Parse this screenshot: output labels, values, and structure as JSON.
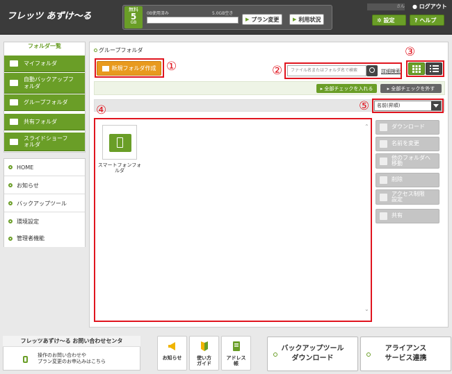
{
  "header": {
    "logo": "フレッツ あずけ〜る",
    "plan_badge": {
      "line1": "無料",
      "line2": "5",
      "line3": "GB"
    },
    "usage_used": "0B使用済み",
    "usage_free": "5.0GB空き",
    "usage_fraction": 0,
    "plan_change_label": "プラン変更",
    "usage_status_label": "利用状況",
    "user_suffix": "さん",
    "logout_label": "ログアウト",
    "settings_label": "設定",
    "help_label": "ヘルプ"
  },
  "sidebar": {
    "title": "フォルダ一覧",
    "folders": [
      {
        "label": "マイフォルダ"
      },
      {
        "label": "自動バックアップフォルダ"
      },
      {
        "label": "グループフォルダ"
      },
      {
        "label": "共有フォルダ"
      },
      {
        "label": "スライドショーフォルダ"
      }
    ],
    "menu": [
      {
        "label": "HOME"
      },
      {
        "label": "お知らせ"
      },
      {
        "label": "バックアップツール"
      },
      {
        "label": "環境設定"
      },
      {
        "label": "管理者機能"
      }
    ]
  },
  "main": {
    "breadcrumb": "グループフォルダ",
    "new_folder_label": "新規フォルダ作成",
    "search_placeholder": "ファイル名またはフォルダ名で検索",
    "advanced_search_label": "詳細検索",
    "check_all_label": "全部チェックを入れる",
    "uncheck_all_label": "全部チェックを外す",
    "sort_value": "名前(昇順)",
    "annotations": [
      "①",
      "②",
      "③",
      "④",
      "⑤"
    ],
    "files": [
      {
        "name": "スマートフォンフォルダ",
        "icon": "smartphone-folder-icon"
      }
    ],
    "actions": [
      {
        "label": "ダウンロード",
        "icon": "download-icon"
      },
      {
        "label": "名前を変更",
        "icon": "pencil-icon"
      },
      {
        "label": "他のフォルダへ移動",
        "icon": "move-folder-icon"
      },
      {
        "label": "削除",
        "icon": "trash-icon"
      },
      {
        "label": "アクセス制限設定",
        "icon": "lock-icon"
      },
      {
        "label": "共有",
        "icon": "share-icon"
      }
    ]
  },
  "footer": {
    "contact_title": "フレッツあずけ〜る お問い合わせセンタ",
    "contact_text_1": "操作のお問い合わせや",
    "contact_text_2": "プラン変更のお申込みはこちら",
    "news_label": "お知らせ",
    "guide_label_1": "使い方",
    "guide_label_2": "ガイド",
    "address_label_1": "アドレス",
    "address_label_2": "帳",
    "backup_download_1": "バックアップツール",
    "backup_download_2": "ダウンロード",
    "alliance_1": "アライアンス",
    "alliance_2": "サービス連携"
  },
  "colors": {
    "accent": "#6a9e27",
    "orange": "#e89a1e",
    "annotation": "#e0141e"
  }
}
